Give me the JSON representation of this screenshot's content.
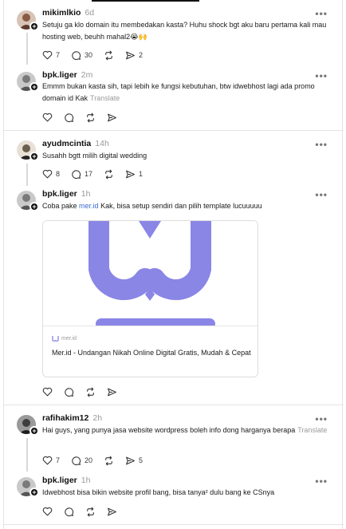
{
  "posts": [
    {
      "username": "mikimlkio",
      "time": "6d",
      "text": "Setuju ga klo domain itu membedakan kasta? Huhu shock bgt aku baru pertama kali mau hosting web, beuhh mahal2😭🙌",
      "likes": "7",
      "replies": "30",
      "shares": "2",
      "avatar_color": "#8a5a44"
    },
    {
      "username": "bpk.liger",
      "time": "2m",
      "text": "Emmm bukan kasta sih, tapi lebih ke fungsi kebutuhan, btw idwebhost lagi ada promo domain id Kak",
      "translate": "Translate",
      "avatar_color": "#7a7a7a"
    },
    {
      "username": "ayudmcintia",
      "time": "14h",
      "text": "Susahh bgtt milih digital wedding",
      "likes": "8",
      "replies": "17",
      "shares": "1",
      "avatar_color": "#6b5e4e"
    },
    {
      "username": "bpk.liger",
      "time": "1h",
      "text_before": "Coba pake ",
      "link": "mer.id",
      "text_after": " Kak, bisa setup sendiri dan pilih template lucuuuuu",
      "avatar_color": "#7a7a7a"
    },
    {
      "username": "rafihakim12",
      "time": "2h",
      "text": "Hai guys, yang punya jasa website wordpress boleh info dong harganya berapa",
      "translate": "Translate",
      "likes": "7",
      "replies": "20",
      "shares": "5",
      "avatar_color": "#3d3d3d"
    },
    {
      "username": "bpk.liger",
      "time": "1h",
      "text": "Idwebhost bisa bikin website profil bang, bisa tanya² dulu bang ke CSnya",
      "avatar_color": "#7a7a7a"
    }
  ],
  "link_card": {
    "source": "mer.id",
    "title": "Mer.id - Undangan Nikah Online Digital Gratis, Mudah & Cepat",
    "brand_color": "#8a86e6"
  },
  "icons": {
    "like": "heart-icon",
    "reply": "comment-icon",
    "repost": "repost-icon",
    "share": "send-icon",
    "more": "more-dots-icon",
    "follow": "plus-icon"
  },
  "more_label": "•••"
}
